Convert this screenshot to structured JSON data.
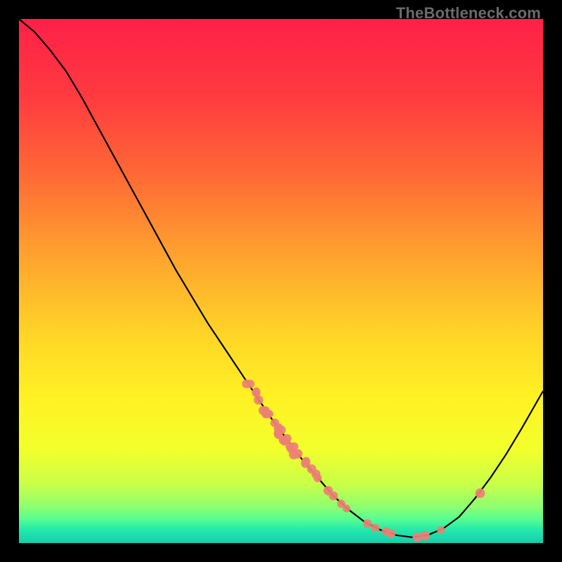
{
  "attribution": "TheBottleneck.com",
  "chart_data": {
    "type": "line",
    "title": "",
    "xlabel": "",
    "ylabel": "",
    "xlim": [
      0,
      100
    ],
    "ylim": [
      0,
      100
    ],
    "curve": [
      {
        "x": 0,
        "y": 100
      },
      {
        "x": 3,
        "y": 97.5
      },
      {
        "x": 6,
        "y": 94
      },
      {
        "x": 9,
        "y": 90
      },
      {
        "x": 12,
        "y": 85
      },
      {
        "x": 15,
        "y": 79.5
      },
      {
        "x": 18,
        "y": 74
      },
      {
        "x": 21,
        "y": 68.5
      },
      {
        "x": 24,
        "y": 63
      },
      {
        "x": 27,
        "y": 57.5
      },
      {
        "x": 30,
        "y": 52
      },
      {
        "x": 33,
        "y": 47
      },
      {
        "x": 36,
        "y": 42
      },
      {
        "x": 39,
        "y": 37.5
      },
      {
        "x": 42,
        "y": 33
      },
      {
        "x": 45,
        "y": 28.5
      },
      {
        "x": 48,
        "y": 24
      },
      {
        "x": 51,
        "y": 20
      },
      {
        "x": 54,
        "y": 16
      },
      {
        "x": 57,
        "y": 12.5
      },
      {
        "x": 60,
        "y": 9
      },
      {
        "x": 63,
        "y": 6.3
      },
      {
        "x": 66,
        "y": 4
      },
      {
        "x": 69,
        "y": 2.5
      },
      {
        "x": 72,
        "y": 1.5
      },
      {
        "x": 75,
        "y": 1.1
      },
      {
        "x": 78,
        "y": 1.5
      },
      {
        "x": 81,
        "y": 2.8
      },
      {
        "x": 84,
        "y": 5
      },
      {
        "x": 87,
        "y": 8.5
      },
      {
        "x": 90,
        "y": 12.5
      },
      {
        "x": 93,
        "y": 17
      },
      {
        "x": 96,
        "y": 22
      },
      {
        "x": 100,
        "y": 29
      }
    ],
    "marker_clusters": [
      {
        "x": 43.5,
        "y": 31.0,
        "count": 2
      },
      {
        "x": 44.8,
        "y": 28.7,
        "count": 2
      },
      {
        "x": 45.7,
        "y": 27.3,
        "count": 1
      },
      {
        "x": 47.2,
        "y": 25.1,
        "count": 5
      },
      {
        "x": 49.0,
        "y": 22.6,
        "count": 2
      },
      {
        "x": 50.0,
        "y": 21.3,
        "count": 4
      },
      {
        "x": 51.0,
        "y": 20.0,
        "count": 4
      },
      {
        "x": 52.2,
        "y": 18.4,
        "count": 3
      },
      {
        "x": 53.0,
        "y": 17.3,
        "count": 2
      },
      {
        "x": 54.5,
        "y": 15.4,
        "count": 3
      },
      {
        "x": 56.0,
        "y": 13.5,
        "count": 2
      },
      {
        "x": 57.0,
        "y": 12.4,
        "count": 1
      },
      {
        "x": 59.0,
        "y": 10.0,
        "count": 1
      },
      {
        "x": 60.0,
        "y": 9.0,
        "count": 1
      },
      {
        "x": 61.5,
        "y": 7.5,
        "count": 1
      },
      {
        "x": 62.5,
        "y": 6.6,
        "count": 1
      },
      {
        "x": 66.5,
        "y": 3.7,
        "count": 1
      },
      {
        "x": 68.0,
        "y": 2.9,
        "count": 1
      },
      {
        "x": 70.0,
        "y": 2.2,
        "count": 1
      },
      {
        "x": 71.0,
        "y": 1.8,
        "count": 1
      },
      {
        "x": 76.0,
        "y": 1.1,
        "count": 1
      },
      {
        "x": 77.5,
        "y": 1.4,
        "count": 1
      },
      {
        "x": 80.5,
        "y": 2.5,
        "count": 1
      },
      {
        "x": 88.0,
        "y": 9.5,
        "count": 1
      }
    ],
    "marker_color": "#ed8074",
    "curve_color": "#000000",
    "gradient_stops": [
      {
        "offset": 0.0,
        "color": "#ff2048"
      },
      {
        "offset": 0.15,
        "color": "#ff3b3f"
      },
      {
        "offset": 0.3,
        "color": "#ff6a35"
      },
      {
        "offset": 0.45,
        "color": "#ffa22e"
      },
      {
        "offset": 0.6,
        "color": "#ffd427"
      },
      {
        "offset": 0.72,
        "color": "#fff124"
      },
      {
        "offset": 0.82,
        "color": "#f3ff2b"
      },
      {
        "offset": 0.89,
        "color": "#c7ff4a"
      },
      {
        "offset": 0.93,
        "color": "#8fff6f"
      },
      {
        "offset": 0.955,
        "color": "#55fd93"
      },
      {
        "offset": 0.975,
        "color": "#23e9a9"
      },
      {
        "offset": 1.0,
        "color": "#10d0b0"
      }
    ]
  }
}
